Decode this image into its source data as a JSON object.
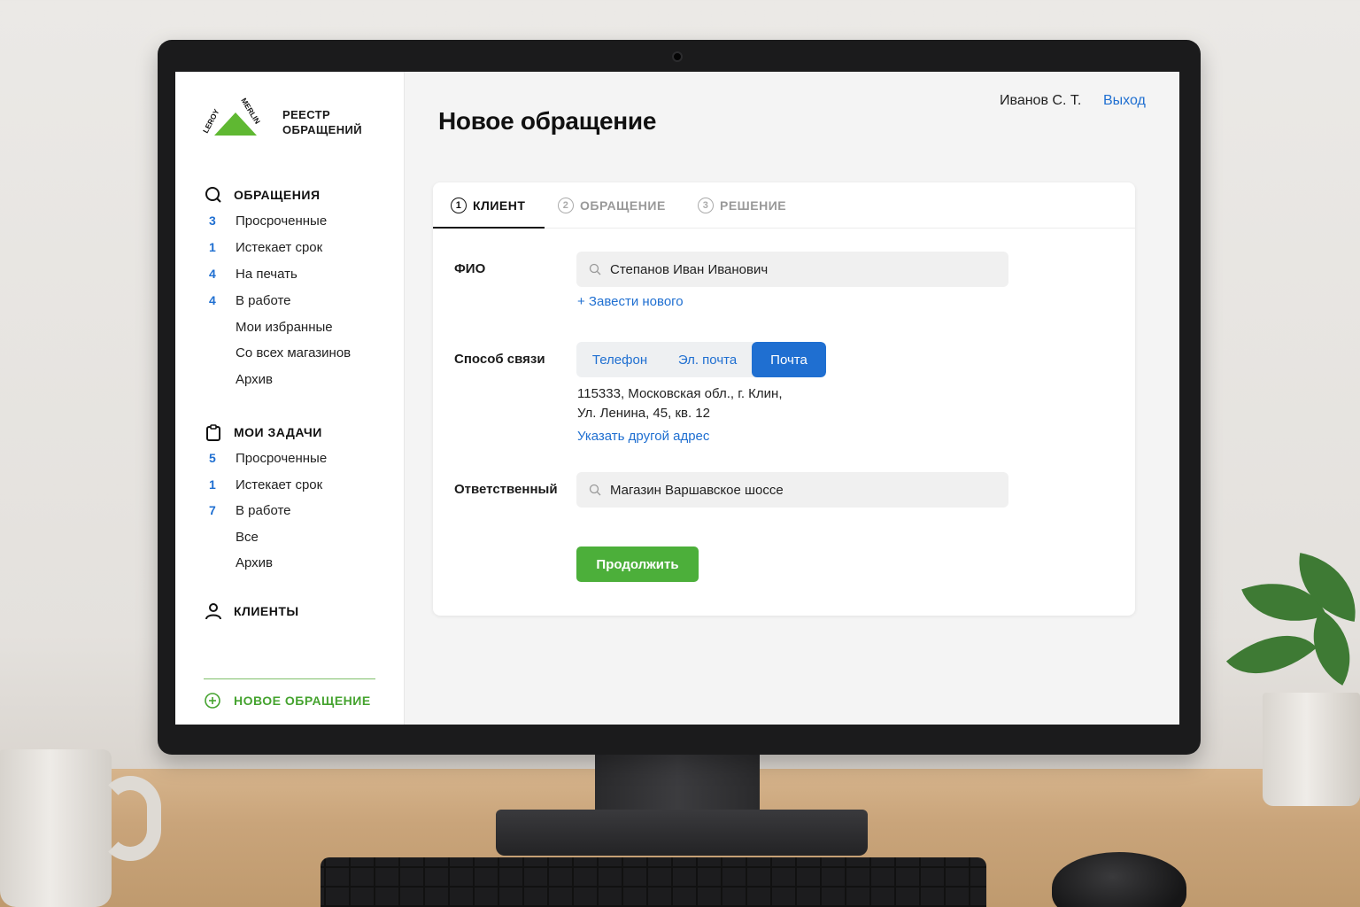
{
  "brand": {
    "line1": "РЕЕСТР",
    "line2": "ОБРАЩЕНИЙ",
    "logo_text": "LEROY MERLIN"
  },
  "header": {
    "title": "Новое обращение",
    "user": "Иванов С. Т.",
    "logout": "Выход"
  },
  "sidebar": {
    "requests": {
      "title": "ОБРАЩЕНИЯ",
      "icon": "search-icon",
      "items": [
        {
          "count": "3",
          "label": "Просроченные"
        },
        {
          "count": "1",
          "label": "Истекает срок"
        },
        {
          "count": "4",
          "label": "На печать"
        },
        {
          "count": "4",
          "label": "В работе"
        },
        {
          "count": "",
          "label": "Мои избранные"
        },
        {
          "count": "",
          "label": "Со всех магазинов"
        },
        {
          "count": "",
          "label": "Архив"
        }
      ]
    },
    "tasks": {
      "title": "МОИ ЗАДАЧИ",
      "icon": "clipboard-icon",
      "items": [
        {
          "count": "5",
          "label": "Просроченные"
        },
        {
          "count": "1",
          "label": "Истекает срок"
        },
        {
          "count": "7",
          "label": "В работе"
        },
        {
          "count": "",
          "label": "Все"
        },
        {
          "count": "",
          "label": "Архив"
        }
      ]
    },
    "clients": {
      "title": "КЛИЕНТЫ",
      "icon": "user-icon"
    },
    "new_request": {
      "label": "НОВОЕ ОБРАЩЕНИЕ",
      "icon": "plus-circle-icon"
    }
  },
  "tabs": [
    {
      "num": "1",
      "label": "КЛИЕНТ",
      "active": true
    },
    {
      "num": "2",
      "label": "ОБРАЩЕНИЕ",
      "active": false
    },
    {
      "num": "3",
      "label": "РЕШЕНИЕ",
      "active": false
    }
  ],
  "form": {
    "fio_label": "ФИО",
    "fio_value": "Степанов Иван Иванович",
    "add_new": "+ Завести нового",
    "contact_label": "Способ связи",
    "contact_options": [
      "Телефон",
      "Эл. почта",
      "Почта"
    ],
    "contact_selected": "Почта",
    "address_line1": "115333, Московская обл., г. Клин,",
    "address_line2": "Ул. Ленина, 45, кв. 12",
    "other_address": "Указать другой адрес",
    "responsible_label": "Ответственный",
    "responsible_value": "Магазин Варшавское шоссе",
    "continue": "Продолжить"
  },
  "colors": {
    "accent_blue": "#1f6fd1",
    "brand_green": "#4caf3a",
    "logo_green": "#5fb832"
  }
}
